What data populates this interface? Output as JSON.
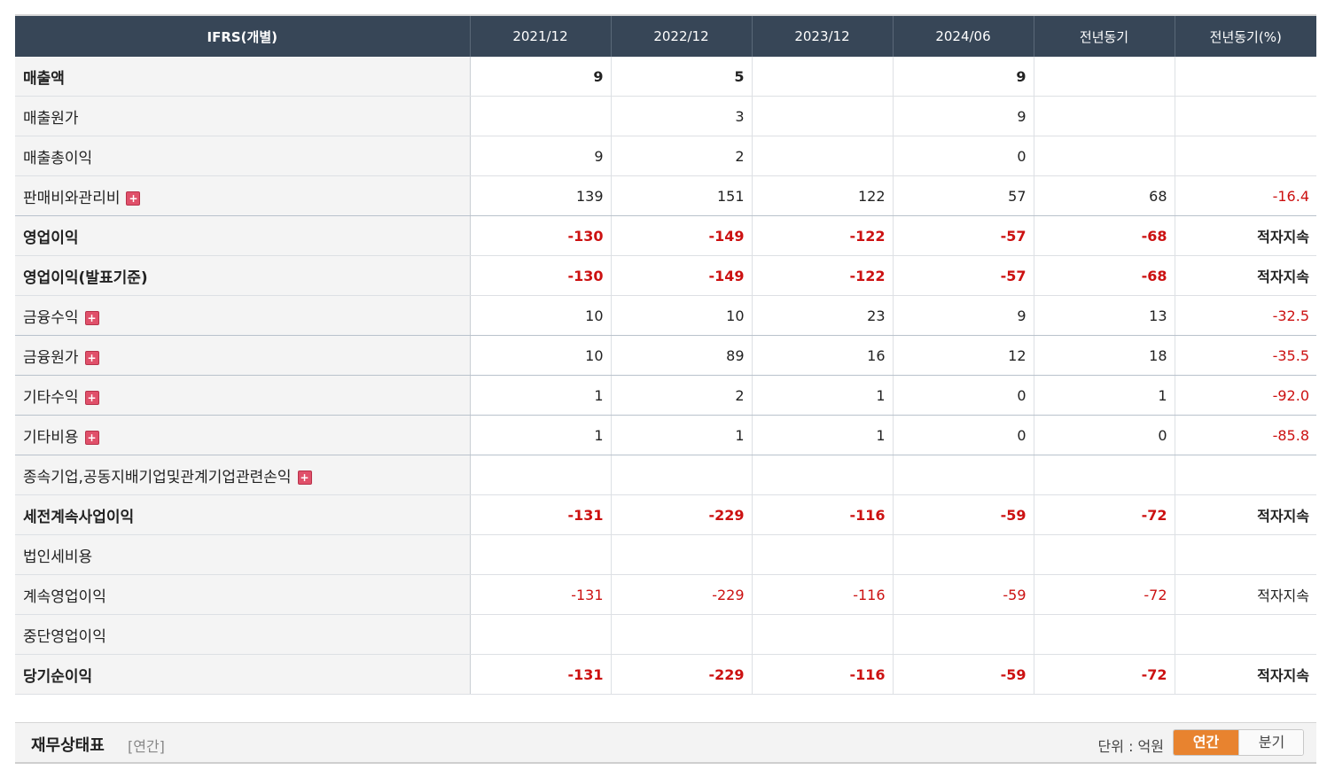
{
  "table": {
    "header": [
      "IFRS(개별)",
      "2021/12",
      "2022/12",
      "2023/12",
      "2024/06",
      "전년동기",
      "전년동기(%)"
    ],
    "rows": [
      {
        "label": "매출액",
        "values": [
          "9",
          "5",
          "",
          "9",
          "",
          ""
        ],
        "expandable": false,
        "bold": true,
        "neg": false
      },
      {
        "label": "매출원가",
        "values": [
          "",
          "3",
          "",
          "9",
          "",
          ""
        ],
        "expandable": false,
        "bold": false,
        "neg": false
      },
      {
        "label": "매출총이익",
        "values": [
          "9",
          "2",
          "",
          "0",
          "",
          ""
        ],
        "expandable": false,
        "bold": false,
        "neg": false
      },
      {
        "label": "판매비와관리비",
        "values": [
          "139",
          "151",
          "122",
          "57",
          "68",
          "-16.4"
        ],
        "expandable": true,
        "bold": false,
        "neg": false
      },
      {
        "label": "영업이익",
        "values": [
          "-130",
          "-149",
          "-122",
          "-57",
          "-68",
          "적자지속"
        ],
        "expandable": false,
        "bold": true,
        "neg": true
      },
      {
        "label": "영업이익(발표기준)",
        "values": [
          "-130",
          "-149",
          "-122",
          "-57",
          "-68",
          "적자지속"
        ],
        "expandable": false,
        "bold": true,
        "neg": true
      },
      {
        "label": "금융수익",
        "values": [
          "10",
          "10",
          "23",
          "9",
          "13",
          "-32.5"
        ],
        "expandable": true,
        "bold": false,
        "neg": false
      },
      {
        "label": "금융원가",
        "values": [
          "10",
          "89",
          "16",
          "12",
          "18",
          "-35.5"
        ],
        "expandable": true,
        "bold": false,
        "neg": false
      },
      {
        "label": "기타수익",
        "values": [
          "1",
          "2",
          "1",
          "0",
          "1",
          "-92.0"
        ],
        "expandable": true,
        "bold": false,
        "neg": false
      },
      {
        "label": "기타비용",
        "values": [
          "1",
          "1",
          "1",
          "0",
          "0",
          "-85.8"
        ],
        "expandable": true,
        "bold": false,
        "neg": false
      },
      {
        "label": "종속기업,공동지배기업및관계기업관련손익",
        "values": [
          "",
          "",
          "",
          "",
          "",
          ""
        ],
        "expandable": true,
        "bold": false,
        "neg": false
      },
      {
        "label": "세전계속사업이익",
        "values": [
          "-131",
          "-229",
          "-116",
          "-59",
          "-72",
          "적자지속"
        ],
        "expandable": false,
        "bold": true,
        "neg": true
      },
      {
        "label": "법인세비용",
        "values": [
          "",
          "",
          "",
          "",
          "",
          ""
        ],
        "expandable": false,
        "bold": false,
        "neg": false
      },
      {
        "label": "계속영업이익",
        "values": [
          "-131",
          "-229",
          "-116",
          "-59",
          "-72",
          "적자지속"
        ],
        "expandable": false,
        "bold": false,
        "neg": true
      },
      {
        "label": "중단영업이익",
        "values": [
          "",
          "",
          "",
          "",
          "",
          ""
        ],
        "expandable": false,
        "bold": false,
        "neg": false
      },
      {
        "label": "당기순이익",
        "values": [
          "-131",
          "-229",
          "-116",
          "-59",
          "-72",
          "적자지속"
        ],
        "expandable": false,
        "bold": true,
        "neg": true
      }
    ]
  },
  "section": {
    "title": "재무상태표",
    "subtitle": "[연간]",
    "unit": "단위 : 억원",
    "toggle_annual": "연간",
    "toggle_quarter": "분기"
  },
  "colors": {
    "header_bg": "#374657",
    "negative": "#cc1111",
    "toggle_active": "#e8832f"
  },
  "icons": {
    "expand": "plus-square-icon"
  }
}
